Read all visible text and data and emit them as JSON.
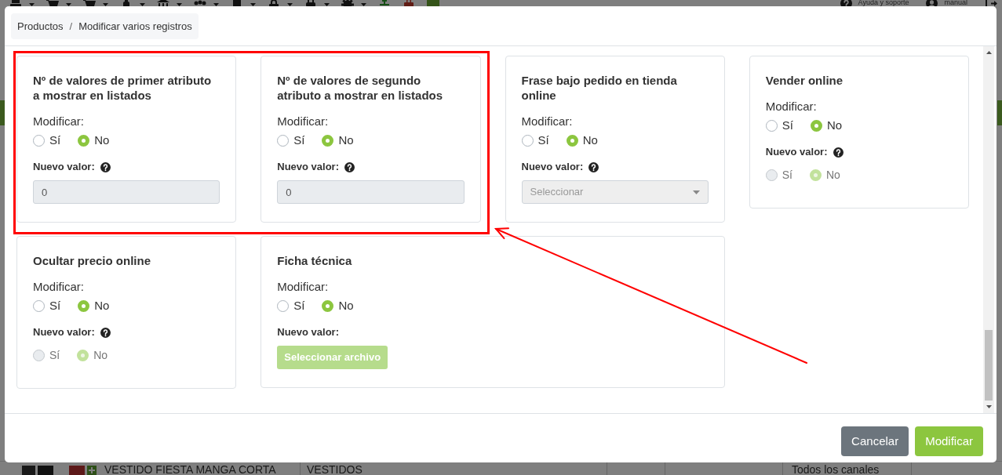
{
  "background_page": {
    "toolbar_links": [
      {
        "kind": "help",
        "label": "Ayuda y soporte"
      },
      {
        "kind": "user",
        "label": "manual"
      }
    ],
    "product_row": {
      "name": "VESTIDO FIESTA MANGA CORTA",
      "category": "VESTIDOS",
      "channels": "Todos los canales"
    }
  },
  "modal": {
    "breadcrumb": {
      "items": [
        "Productos",
        "Modificar varios registros"
      ],
      "separator": "/"
    },
    "fields": [
      {
        "title": "Nº de valores de primer atributo a mostrar en listados",
        "modify": {
          "label": "Modificar:",
          "options": [
            {
              "label": "Sí",
              "selected": false
            },
            {
              "label": "No",
              "selected": true
            }
          ]
        },
        "new_value": {
          "label": "Nuevo valor:",
          "help": true,
          "kind": "text",
          "value": "0",
          "disabled": true
        }
      },
      {
        "title": "Nº de valores de segundo atributo a mostrar en listados",
        "modify": {
          "label": "Modificar:",
          "options": [
            {
              "label": "Sí",
              "selected": false
            },
            {
              "label": "No",
              "selected": true
            }
          ]
        },
        "new_value": {
          "label": "Nuevo valor:",
          "help": true,
          "kind": "text",
          "value": "0",
          "disabled": true
        }
      },
      {
        "title": "Frase bajo pedido en tienda online",
        "modify": {
          "label": "Modificar:",
          "options": [
            {
              "label": "Sí",
              "selected": false
            },
            {
              "label": "No",
              "selected": true
            }
          ]
        },
        "new_value": {
          "label": "Nuevo valor:",
          "help": true,
          "kind": "select",
          "placeholder": "Seleccionar",
          "disabled": true
        }
      },
      {
        "title": "Vender online",
        "modify": {
          "label": "Modificar:",
          "options": [
            {
              "label": "Sí",
              "selected": false
            },
            {
              "label": "No",
              "selected": true
            }
          ]
        },
        "new_value": {
          "label": "Nuevo valor:",
          "help": true,
          "kind": "radio",
          "disabled": true,
          "options": [
            {
              "label": "Sí",
              "selected": false
            },
            {
              "label": "No",
              "selected": true
            }
          ]
        }
      },
      {
        "title": "Ocultar precio online",
        "modify": {
          "label": "Modificar:",
          "options": [
            {
              "label": "Sí",
              "selected": false
            },
            {
              "label": "No",
              "selected": true
            }
          ]
        },
        "new_value": {
          "label": "Nuevo valor:",
          "help": true,
          "kind": "radio",
          "disabled": true,
          "options": [
            {
              "label": "Sí",
              "selected": false
            },
            {
              "label": "No",
              "selected": true
            }
          ]
        }
      },
      {
        "title": "Ficha técnica",
        "modify": {
          "label": "Modificar:",
          "options": [
            {
              "label": "Sí",
              "selected": false
            },
            {
              "label": "No",
              "selected": true
            }
          ]
        },
        "new_value": {
          "label": "Nuevo valor:",
          "help": false,
          "kind": "file",
          "button_label": "Seleccionar archivo",
          "disabled": true
        }
      }
    ],
    "buttons": [
      {
        "label": "Cancelar",
        "kind": "secondary"
      },
      {
        "label": "Modificar",
        "kind": "primary"
      }
    ]
  }
}
